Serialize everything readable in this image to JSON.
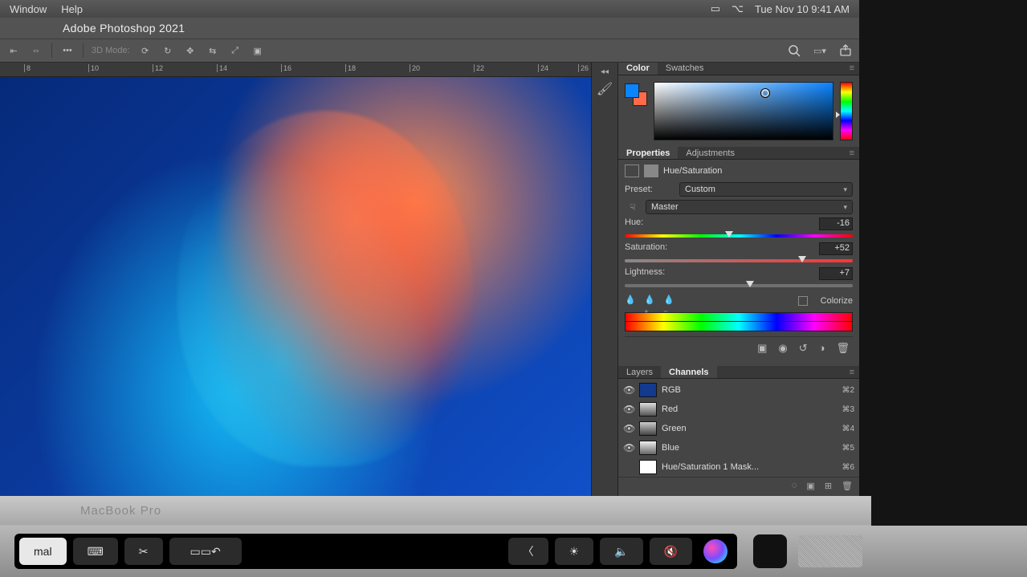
{
  "mac": {
    "menu_left": [
      "Window",
      "Help"
    ],
    "clock": "Tue Nov 10  9:41 AM"
  },
  "app": {
    "title": "Adobe Photoshop 2021",
    "option_mode_label": "3D Mode:"
  },
  "ruler_ticks": [
    "8",
    "10",
    "12",
    "14",
    "16",
    "18",
    "20",
    "22",
    "24",
    "26"
  ],
  "panels": {
    "color": {
      "tab1": "Color",
      "tab2": "Swatches"
    },
    "properties": {
      "tab1": "Properties",
      "tab2": "Adjustments",
      "type_label": "Hue/Saturation",
      "preset_label": "Preset:",
      "preset_value": "Custom",
      "channel_value": "Master",
      "hue_label": "Hue:",
      "hue_value": "-16",
      "sat_label": "Saturation:",
      "sat_value": "+52",
      "light_label": "Lightness:",
      "light_value": "+7",
      "colorize_label": "Colorize"
    },
    "layers": {
      "tab1": "Layers",
      "tab2": "Channels"
    },
    "channels": [
      {
        "name": "RGB",
        "shortcut": "⌘2"
      },
      {
        "name": "Red",
        "shortcut": "⌘3"
      },
      {
        "name": "Green",
        "shortcut": "⌘4"
      },
      {
        "name": "Blue",
        "shortcut": "⌘5"
      },
      {
        "name": "Hue/Saturation 1 Mask...",
        "shortcut": "⌘6"
      }
    ]
  },
  "laptop": {
    "model": "MacBook Pro"
  },
  "touchbar": {
    "mode_suffix": "mal"
  }
}
